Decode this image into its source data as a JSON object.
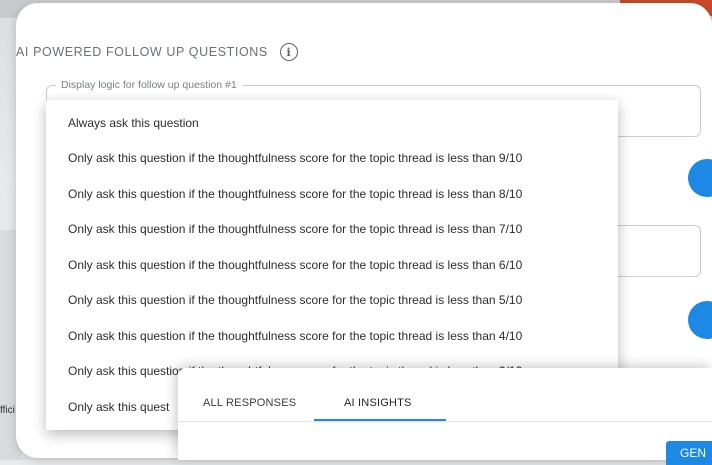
{
  "section": {
    "title": "AI POWERED FOLLOW UP QUESTIONS",
    "info_icon": "info-icon"
  },
  "field": {
    "legend": "Display logic for follow up question #1"
  },
  "dropdown": {
    "options": [
      "Always ask this question",
      "Only ask this question if the thoughtfulness score for the topic thread is less than 9/10",
      "Only ask this question if the thoughtfulness score for the topic thread is less than 8/10",
      "Only ask this question if the thoughtfulness score for the topic thread is less than 7/10",
      "Only ask this question if the thoughtfulness score for the topic thread is less than 6/10",
      "Only ask this question if the thoughtfulness score for the topic thread is less than 5/10",
      "Only ask this question if the thoughtfulness score for the topic thread is less than 4/10",
      "Only ask this question if the thoughtfulness score for the topic thread is less than 3/10",
      "Only ask this quest"
    ]
  },
  "insights": {
    "tabs": [
      {
        "label": "ALL RESPONSES"
      },
      {
        "label": "AI INSIGHTS"
      }
    ],
    "button_label": "GEN"
  },
  "background": {
    "left_text": "ffici"
  },
  "colors": {
    "accent": "#1e88e5",
    "brand_orange": "#c9492a"
  }
}
